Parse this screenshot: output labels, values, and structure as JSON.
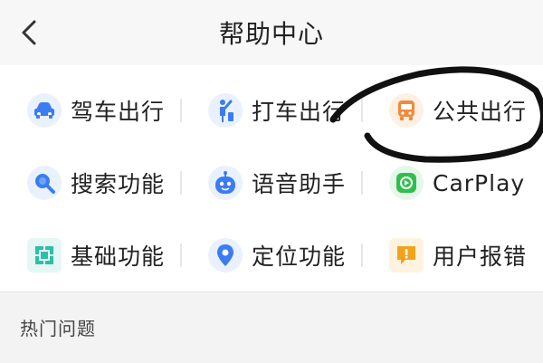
{
  "header": {
    "title": "帮助中心",
    "back_icon": "chevron-left-icon"
  },
  "categories": [
    {
      "label": "驾车出行",
      "icon": "car-icon",
      "color": "#3b7cf0",
      "bg": "#e9f1ff"
    },
    {
      "label": "打车出行",
      "icon": "person-hailing-icon",
      "color": "#3b7cf0",
      "bg": "#e9f1ff"
    },
    {
      "label": "公共出行",
      "icon": "bus-icon",
      "color": "#f28a3b",
      "bg": "#fff0e4"
    },
    {
      "label": "搜索功能",
      "icon": "search-icon",
      "color": "#3b7cf0",
      "bg": "#e9f1ff"
    },
    {
      "label": "语音助手",
      "icon": "voice-assistant-robot-icon",
      "color": "#3b7cf0",
      "bg": "#e9f1ff"
    },
    {
      "label": "CarPlay",
      "icon": "carplay-icon",
      "color": "#2fbf4f",
      "bg": "#e6f7ea"
    },
    {
      "label": "基础功能",
      "icon": "basic-functions-icon",
      "color": "#2dbfa8",
      "bg": "#e5f7f4"
    },
    {
      "label": "定位功能",
      "icon": "location-pin-icon",
      "color": "#3b7cf0",
      "bg": "#e9f1ff"
    },
    {
      "label": "用户报错",
      "icon": "report-error-icon",
      "color": "#f2a21b",
      "bg": "#fff3e0"
    }
  ],
  "hot_section": {
    "label": "热门问题"
  }
}
